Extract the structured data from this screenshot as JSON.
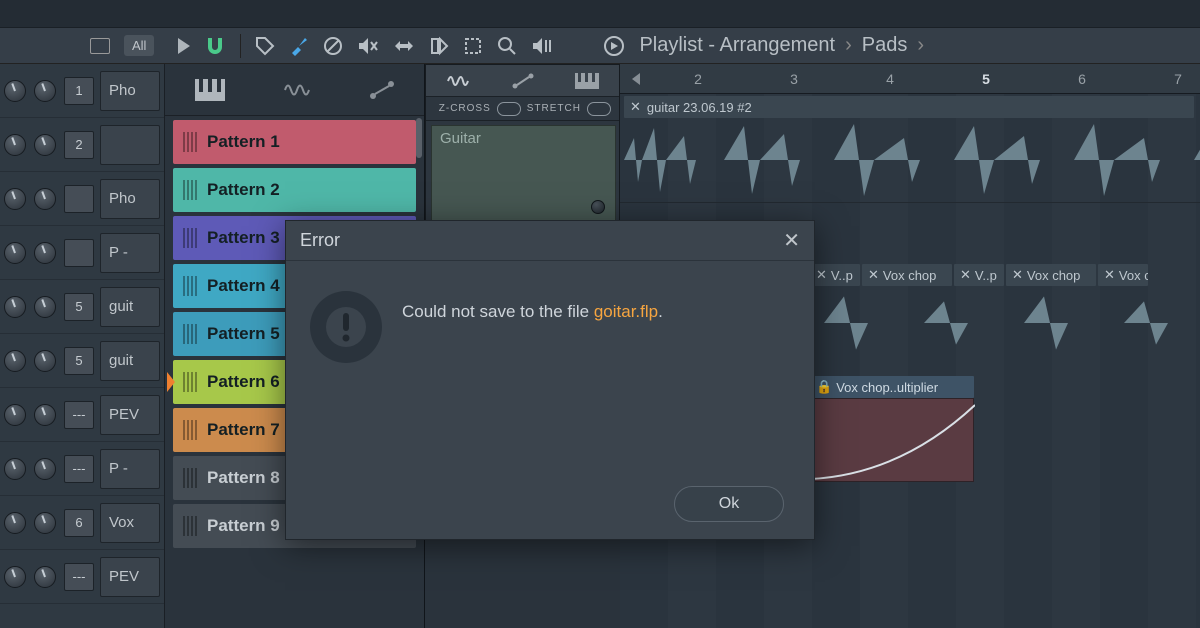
{
  "toolbar": {
    "all_label": "All",
    "breadcrumb": [
      "Playlist - Arrangement",
      "Pads"
    ]
  },
  "channels": [
    {
      "num": "1",
      "name": "Pho"
    },
    {
      "num": "2",
      "name": ""
    },
    {
      "num": "",
      "name": "Pho"
    },
    {
      "num": "",
      "name": "P -"
    },
    {
      "num": "5",
      "name": "guit"
    },
    {
      "num": "5",
      "name": "guit"
    },
    {
      "num": "---",
      "name": "PEV"
    },
    {
      "num": "---",
      "name": "P -"
    },
    {
      "num": "6",
      "name": "Vox"
    },
    {
      "num": "---",
      "name": "PEV"
    }
  ],
  "patterns": [
    {
      "label": "Pattern 1",
      "color": "#c15b6d"
    },
    {
      "label": "Pattern 2",
      "color": "#4fb7a8"
    },
    {
      "label": "Pattern 3",
      "color": "#5e5ab7"
    },
    {
      "label": "Pattern 4",
      "color": "#3fa8c4"
    },
    {
      "label": "Pattern 5",
      "color": "#3d9cbb"
    },
    {
      "label": "Pattern 6",
      "color": "#a7c84a",
      "selected": true
    },
    {
      "label": "Pattern 7",
      "color": "#cc8b4d"
    },
    {
      "label": "Pattern 8",
      "color": "#444c54",
      "text": "#c8ced3"
    },
    {
      "label": "Pattern 9",
      "color": "#444c54",
      "text": "#c8ced3"
    }
  ],
  "editor": {
    "zcross": "Z-CROSS",
    "stretch": "STRETCH",
    "clip_title": "Guitar"
  },
  "ruler_numbers": [
    "2",
    "3",
    "4",
    "5",
    "6",
    "7"
  ],
  "playlist_clips": {
    "audio1": "guitar 23.06.19 #2",
    "vox_items": [
      "V..p",
      "Vox chop",
      "V..p",
      "Vox chop",
      "Vox c"
    ],
    "vox_multiplier": "Vox chop..ultiplier"
  },
  "dialog": {
    "title": "Error",
    "message_prefix": "Could not save to the file ",
    "filename": "goitar.flp",
    "message_suffix": ".",
    "ok_label": "Ok"
  }
}
